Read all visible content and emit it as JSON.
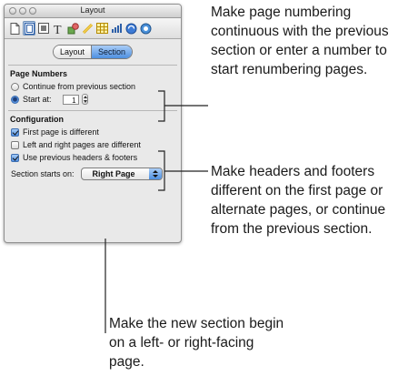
{
  "window": {
    "title": "Layout"
  },
  "toolbar": {
    "icons": [
      "document-icon",
      "layout-icon",
      "wrap-icon",
      "text-icon",
      "graphic-icon",
      "metrics-icon",
      "table-icon",
      "chart-icon",
      "link-icon",
      "quicktime-icon"
    ],
    "selected": "layout-icon"
  },
  "tabs": {
    "layout": "Layout",
    "section": "Section",
    "selected": "Section"
  },
  "page_numbers": {
    "heading": "Page Numbers",
    "continue_label": "Continue from previous section",
    "start_at_label": "Start at:",
    "start_at_value": "1",
    "selected": "start_at"
  },
  "configuration": {
    "heading": "Configuration",
    "first_page_label": "First page is different",
    "first_page_checked": true,
    "left_right_label": "Left and right pages are different",
    "left_right_checked": false,
    "use_previous_label": "Use previous headers & footers",
    "use_previous_checked": true,
    "section_starts_label": "Section starts on:",
    "section_starts_value": "Right Page"
  },
  "callouts": {
    "numbering": "Make page numbering continuous with the previous section or enter a number to start renumbering pages.",
    "headers": "Make headers and footers different on the first page or alternate pages, or continue from the previous section.",
    "section_start": "Make the new section begin on a left- or right-facing page."
  },
  "colors": {
    "accent": "#4d8fe0",
    "window_bg": "#e9e9e9",
    "text": "#1a1a1a"
  }
}
